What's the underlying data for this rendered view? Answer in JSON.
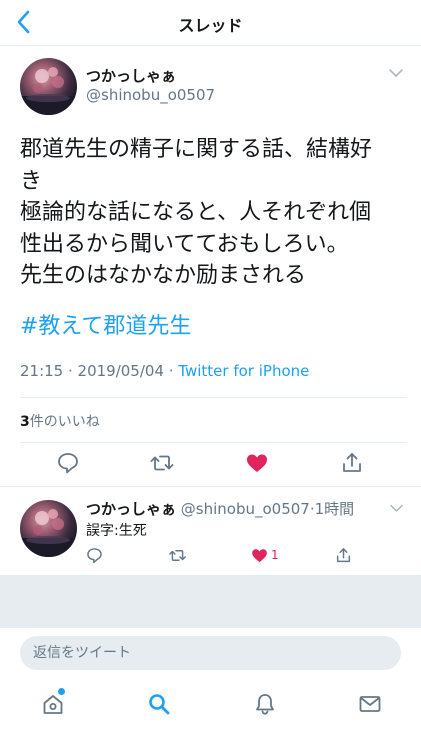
{
  "nav": {
    "title": "スレッド",
    "back_icon": "chevron-left-icon"
  },
  "tweet": {
    "display_name": "つかっしゃぁ",
    "handle": "@shinobu_o0507",
    "body_lines": [
      "郡道先生の精子に関する話、結構好",
      "き",
      "極論的な話になると、人それぞれ個",
      "性出るから聞いてておもしろい。",
      "先生のはなかなか励まされる"
    ],
    "hashtag": "#教えて郡道先生",
    "time": "21:15 · 2019/05/04 · ",
    "source": "Twitter for iPhone",
    "likes_count": "3",
    "likes_label": "件のいいね",
    "liked": true
  },
  "reply": {
    "display_name": "つかっしゃぁ",
    "handle": "@shinobu_o0507",
    "age": "·1時間",
    "text": "誤字:生死",
    "like_count": "1"
  },
  "reply_bar": {
    "placeholder": "返信をツイート"
  },
  "tabbar": {
    "items": [
      "home-icon",
      "search-icon",
      "notifications-icon",
      "messages-icon"
    ],
    "active": "search-icon"
  },
  "colors": {
    "accent": "#1da1f2",
    "like": "#e0245e",
    "secondary": "#657786",
    "divider": "#e6ecf0"
  }
}
